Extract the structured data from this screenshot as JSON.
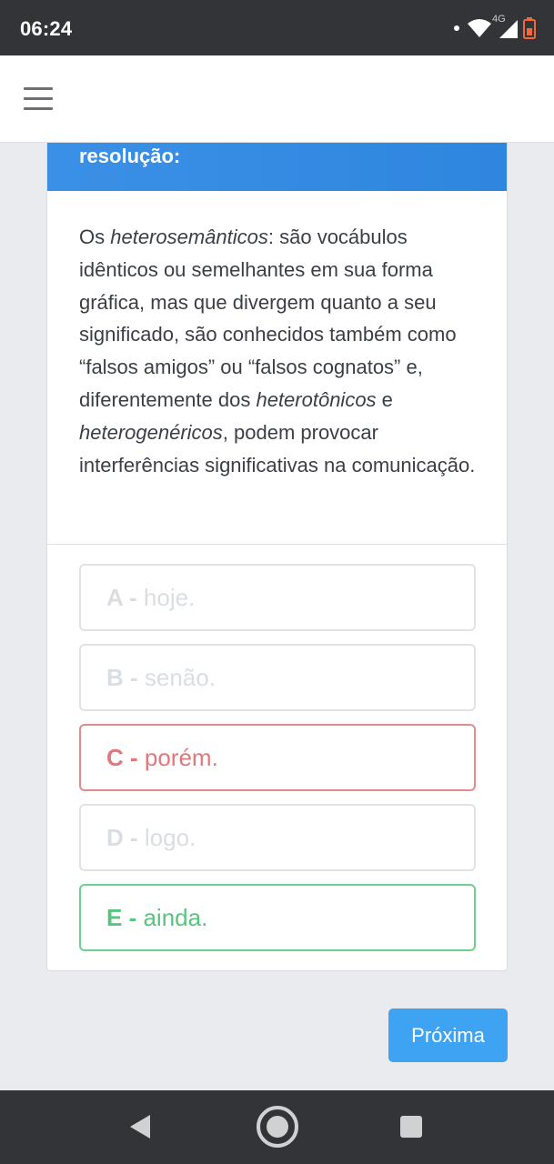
{
  "status_bar": {
    "time": "06:24",
    "network_label": "4G",
    "icons": [
      "notification-dot-icon",
      "wifi-icon",
      "signal-icon",
      "battery-low-icon"
    ],
    "battery_color": "#f0683c"
  },
  "header": {
    "menu_icon": "hamburger-menu-icon"
  },
  "card": {
    "title": "resolução:",
    "accent_color": "#2f86de",
    "resolution": {
      "p1": " Os ",
      "term1": "heterosemânticos",
      "p2": ": são vocábulos idênticos ou semelhantes em sua forma gráfica, mas que divergem quanto a seu significado, são conhecidos também como “falsos amigos” ou “falsos cognatos” e, diferentemente dos ",
      "term2": "heterotônicos",
      "p3": " e ",
      "term3": "heterogenéricos",
      "p4": ", podem provocar interferências significativas na comunicação."
    }
  },
  "options": [
    {
      "letter": "A",
      "sep": " - ",
      "text": "hoje.",
      "state": "neutral"
    },
    {
      "letter": "B",
      "sep": " - ",
      "text": "senão.",
      "state": "neutral"
    },
    {
      "letter": "C",
      "sep": " - ",
      "text": "porém.",
      "state": "wrong"
    },
    {
      "letter": "D",
      "sep": " - ",
      "text": "logo.",
      "state": "neutral"
    },
    {
      "letter": "E",
      "sep": " - ",
      "text": "ainda.",
      "state": "correct"
    }
  ],
  "colors": {
    "wrong": "#e2777c",
    "correct": "#58c57e",
    "primary_button": "#3fa3f3"
  },
  "footer": {
    "next_label": "Próxima"
  },
  "nav_bar": {
    "icons": [
      "back-triangle-icon",
      "home-circle-icon",
      "recent-apps-square-icon"
    ]
  }
}
